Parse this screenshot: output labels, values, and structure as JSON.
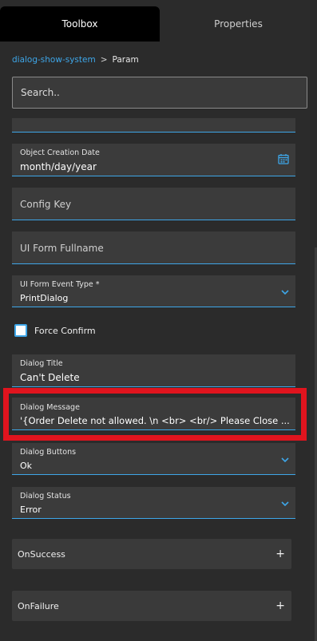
{
  "tabs": [
    {
      "label": "Toolbox",
      "active": true
    },
    {
      "label": "Properties",
      "active": false
    }
  ],
  "breadcrumb": {
    "link": "dialog-show-system",
    "separator": ">",
    "current": "Param"
  },
  "search": {
    "placeholder": "Search.."
  },
  "fields": {
    "object_creation_date": {
      "label": "Object Creation Date",
      "value": "month/day/year",
      "icon": "calendar-icon"
    },
    "config_key": {
      "placeholder": "Config Key"
    },
    "ui_form_fullname": {
      "placeholder": "UI Form Fullname"
    },
    "ui_form_event_type": {
      "label": "UI Form Event Type *",
      "value": "PrintDialog"
    },
    "force_confirm": {
      "label": "Force Confirm",
      "checked": false
    },
    "dialog_title": {
      "label": "Dialog Title",
      "value": "Can't Delete"
    },
    "dialog_message": {
      "label": "Dialog Message",
      "value": "'{Order Delete not allowed.  \\n  <br>  <br/> Please Close ..."
    },
    "dialog_buttons": {
      "label": "Dialog Buttons",
      "value": "Ok"
    },
    "dialog_status": {
      "label": "Dialog Status",
      "value": "Error"
    }
  },
  "sections": [
    {
      "label": "OnSuccess",
      "icon": "plus-icon"
    },
    {
      "label": "OnFailure",
      "icon": "plus-icon"
    }
  ],
  "colors": {
    "accent": "#3ea6e8",
    "highlight": "#e0141e",
    "background": "#2b2b2b",
    "field_bg": "#3b3b3b"
  }
}
